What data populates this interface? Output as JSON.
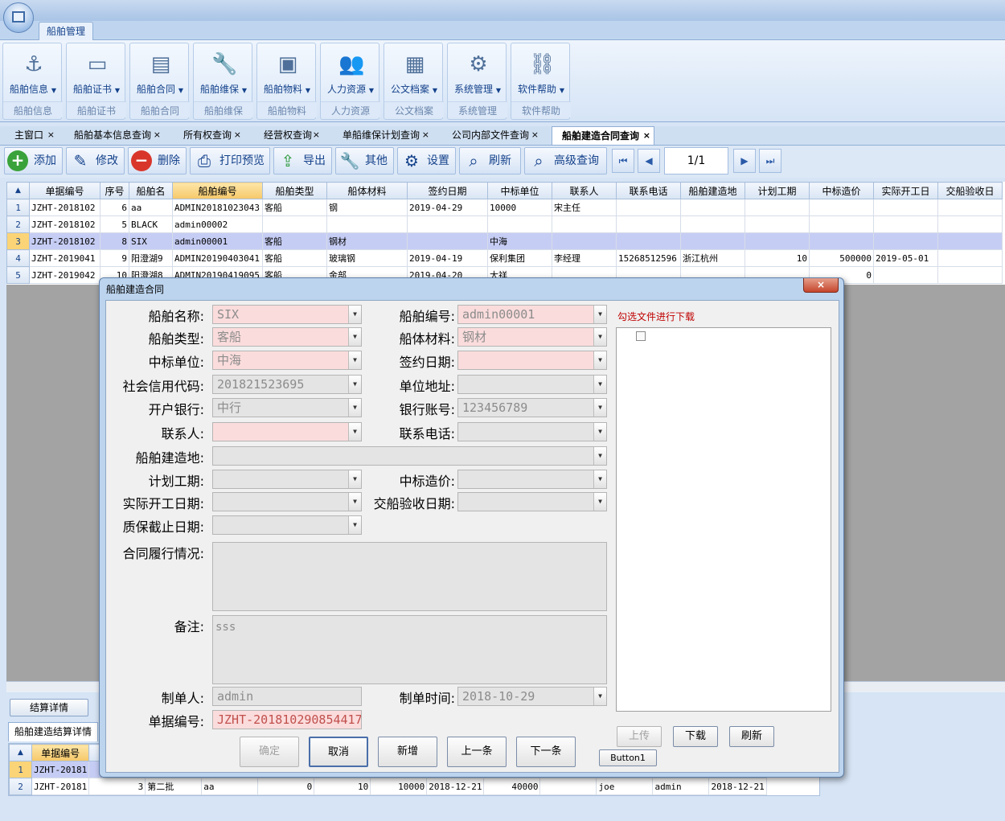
{
  "ribbon": {
    "tab": "船舶管理",
    "groups": [
      {
        "label": "船舶信息",
        "caption": "船舶信息",
        "icon": "anchor-icon",
        "glyph": "⚓"
      },
      {
        "label": "船舶证书",
        "caption": "船舶证书",
        "icon": "certificate-icon",
        "glyph": "▭"
      },
      {
        "label": "船舶合同",
        "caption": "船舶合同",
        "icon": "contract-icon",
        "glyph": "▤"
      },
      {
        "label": "船舶维保",
        "caption": "船舶维保",
        "icon": "wrench-icon",
        "glyph": "🔧"
      },
      {
        "label": "船舶物料",
        "caption": "船舶物料",
        "icon": "box-icon",
        "glyph": "▣"
      },
      {
        "label": "人力资源",
        "caption": "人力资源",
        "icon": "people-icon",
        "glyph": "👥"
      },
      {
        "label": "公文档案",
        "caption": "公文档案",
        "icon": "archive-icon",
        "glyph": "▦"
      },
      {
        "label": "系统管理",
        "caption": "系统管理",
        "icon": "gear-icon",
        "glyph": "⚙"
      },
      {
        "label": "软件帮助",
        "caption": "软件帮助",
        "icon": "link-icon",
        "glyph": "⛓"
      }
    ]
  },
  "doc_tabs": [
    {
      "label": "主窗口",
      "close": "×"
    },
    {
      "label": "船舶基本信息查询",
      "close": "×"
    },
    {
      "label": "所有权查询",
      "close": "×"
    },
    {
      "label": "经营权查询",
      "close": "×"
    },
    {
      "label": "单船维保计划查询",
      "close": "×"
    },
    {
      "label": "公司内部文件查询",
      "close": "×"
    },
    {
      "label": "船舶建造合同查询",
      "close": "×"
    }
  ],
  "toolbar": {
    "add": "添加",
    "edit": "修改",
    "delete": "删除",
    "print": "打印预览",
    "export": "导出",
    "other": "其他",
    "settings": "设置",
    "refresh": "刷新",
    "advanced": "高级查询",
    "page": "1/1",
    "first_glyph": "⏮",
    "prev_glyph": "◀",
    "next_glyph": "▶",
    "last_glyph": "⏭"
  },
  "grid": {
    "corner": "▲",
    "columns": [
      "单据编号",
      "序号",
      "船舶名",
      "船舶编号",
      "船舶类型",
      "船体材料",
      "签约日期",
      "中标单位",
      "联系人",
      "联系电话",
      "船舶建造地",
      "计划工期",
      "中标造价",
      "实际开工日",
      "交船验收日"
    ],
    "rows": [
      {
        "rn": "1",
        "c": [
          "JZHT-2018102",
          "6",
          "aa",
          "ADMIN20181023043",
          "客船",
          "钢",
          "2019-04-29",
          "10000",
          "宋主任",
          "",
          "",
          "",
          "",
          "",
          ""
        ]
      },
      {
        "rn": "2",
        "c": [
          "JZHT-2018102",
          "5",
          "BLACK",
          "admin00002",
          "",
          "",
          "",
          "",
          "",
          "",
          "",
          "",
          "",
          "",
          ""
        ]
      },
      {
        "rn": "3",
        "c": [
          "JZHT-2018102",
          "8",
          "SIX",
          "admin00001",
          "客船",
          "钢材",
          "",
          "中海",
          "",
          "",
          "",
          "",
          "",
          "",
          ""
        ]
      },
      {
        "rn": "4",
        "c": [
          "JZHT-2019041",
          "9",
          "阳澄湖9",
          "ADMIN20190403041",
          "客船",
          "玻璃钢",
          "2019-04-19",
          "保利集团",
          "李经理",
          "15268512596",
          "浙江杭州",
          "10",
          "500000",
          "2019-05-01",
          ""
        ]
      },
      {
        "rn": "5",
        "c": [
          "JZHT-2019042",
          "10",
          "阳澄湖8",
          "ADMIN20190419095",
          "客船",
          "金部",
          "2019-04-20",
          "大祥",
          "",
          "",
          "",
          "",
          "0",
          "",
          ""
        ]
      }
    ]
  },
  "lower": {
    "settle_button": "结算详情",
    "sub_tab": "船舶建造结算详情",
    "sub_header": "单据编号",
    "sub_rows": [
      {
        "rn": "1",
        "c": [
          "JZHT-20181",
          "",
          "",
          "",
          "",
          "",
          "",
          "",
          "",
          "",
          "",
          "",
          ""
        ]
      },
      {
        "rn": "2",
        "c": [
          "JZHT-20181",
          "3",
          "第二批",
          "aa",
          "0",
          "10",
          "10000",
          "2018-12-21",
          "40000",
          "",
          "joe",
          "admin",
          "2018-12-21"
        ]
      }
    ]
  },
  "dialog": {
    "title": "船舶建造合同",
    "close": "×",
    "labels": {
      "ship_name": "船舶名称:",
      "ship_no": "船舶编号:",
      "ship_type": "船舶类型:",
      "hull": "船体材料:",
      "bidder": "中标单位:",
      "sign_date": "签约日期:",
      "credit": "社会信用代码:",
      "address": "单位地址:",
      "bank": "开户银行:",
      "account": "银行账号:",
      "contact": "联系人:",
      "phone": "联系电话:",
      "build_place": "船舶建造地:",
      "period": "计划工期:",
      "price": "中标造价:",
      "start": "实际开工日期:",
      "delivery": "交船验收日期:",
      "warranty": "质保截止日期:",
      "perform": "合同履行情况:",
      "remark": "备注:",
      "maker": "制单人:",
      "make_time": "制单时间:",
      "doc_no": "单据编号:"
    },
    "values": {
      "ship_name": "SIX",
      "ship_no": "admin00001",
      "ship_type": "客船",
      "hull": "钢材",
      "bidder": "中海",
      "sign_date": "",
      "credit": "201821523695",
      "address": "",
      "bank": "中行",
      "account": "123456789",
      "contact": "",
      "phone": "",
      "build_place": "",
      "period": "",
      "price": "",
      "start": "",
      "delivery": "",
      "warranty": "",
      "perform": "",
      "remark": "sss",
      "maker": "admin",
      "make_time": "2018-10-29",
      "doc_no": "JZHT-201810290854417"
    },
    "download_hint": "勾选文件进行下载",
    "buttons": {
      "ok": "确定",
      "cancel": "取消",
      "new": "新增",
      "prev": "上一条",
      "next": "下一条",
      "upload": "上传",
      "download": "下载",
      "refresh": "刷新",
      "button1": "Button1"
    }
  },
  "colors": {
    "accent": "#15428b",
    "selected_row": "#c6cdf4",
    "required_field": "#fbdcdc",
    "hint": "#c00000"
  }
}
